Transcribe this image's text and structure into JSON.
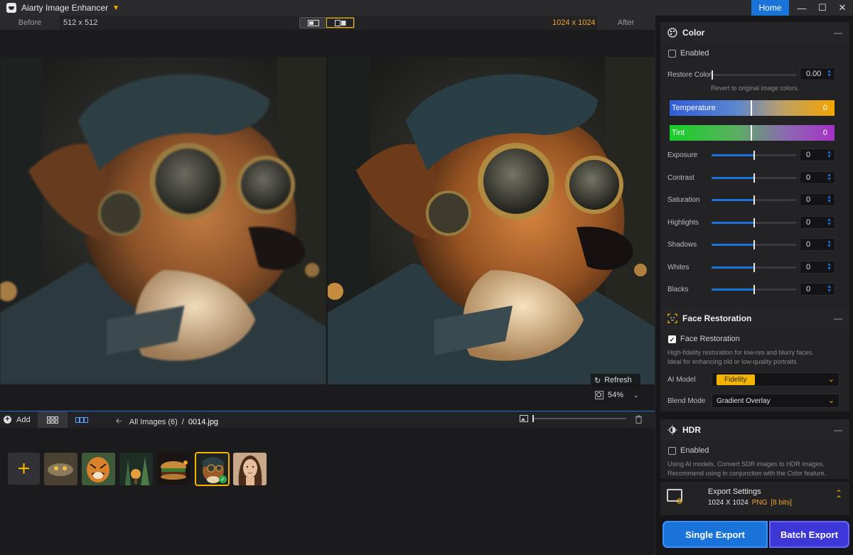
{
  "app": {
    "title": "Aiarty Image Enhancer",
    "home_label": "Home"
  },
  "window_controls": {
    "minimize": "—",
    "maximize": "☐",
    "close": "✕"
  },
  "compare": {
    "before_label": "Before",
    "before_resolution": "512 x 512",
    "after_resolution": "1024 x 1024",
    "after_label": "After"
  },
  "preview": {
    "refresh_label": "Refresh",
    "zoom": "54%"
  },
  "browser": {
    "add_label": "Add",
    "all_images": "All Images (6)",
    "separator": "/",
    "current_file": "0014.jpg",
    "add_tile": "+"
  },
  "thumbnails": [
    {
      "name": "thumb-owl",
      "selected": false
    },
    {
      "name": "thumb-tiger",
      "selected": false
    },
    {
      "name": "thumb-forest",
      "selected": false
    },
    {
      "name": "thumb-burger",
      "selected": false
    },
    {
      "name": "thumb-dog",
      "selected": true
    },
    {
      "name": "thumb-portrait",
      "selected": false
    }
  ],
  "color": {
    "title": "Color",
    "enabled_label": "Enabled",
    "restore_label": "Restore Color",
    "restore_value": "0.00",
    "restore_hint": "Revert to original image colors.",
    "temperature_label": "Temperature",
    "temperature_value": "0",
    "tint_label": "Tint",
    "tint_value": "0",
    "adjustments": [
      {
        "label": "Exposure",
        "value": "0"
      },
      {
        "label": "Contrast",
        "value": "0"
      },
      {
        "label": "Saturation",
        "value": "0"
      },
      {
        "label": "Highlights",
        "value": "0"
      },
      {
        "label": "Shadows",
        "value": "0"
      },
      {
        "label": "Whites",
        "value": "0"
      },
      {
        "label": "Blacks",
        "value": "0"
      }
    ],
    "slider_level": 0.5
  },
  "face": {
    "title": "Face Restoration",
    "checkbox_label": "Face Restoration",
    "desc1": "High-fidelity restoration for low-res and blurry faces.",
    "desc2": "Ideal for enhancing old or low-quality portraits.",
    "model_label": "AI Model",
    "model_value": "Fidelity",
    "blend_label": "Blend Mode",
    "blend_value": "Gradient Overlay"
  },
  "hdr": {
    "title": "HDR",
    "enabled_label": "Enabled",
    "desc1": "Using AI models, Convert SDR images to HDR images.",
    "desc2": "Recommend using in conjunction with the Color feature."
  },
  "export": {
    "title": "Export Settings",
    "size": "1024 X 1024",
    "format": "PNG",
    "bits": "[8 bits]",
    "single_label": "Single Export",
    "batch_label": "Batch Export"
  },
  "colors": {
    "accent_blue": "#1a73d9",
    "accent_orange": "#f4b400",
    "batch_purple": "#3d37d8"
  }
}
